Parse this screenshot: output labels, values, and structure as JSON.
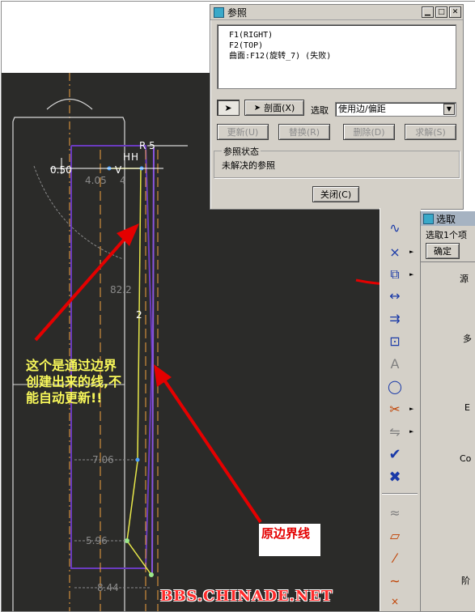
{
  "reference_dialog": {
    "title": "参照",
    "items": [
      "F1(RIGHT)",
      "F2(TOP)",
      "曲面:F12(旋转_7) (失败)"
    ],
    "pick_label": "剖面(X)",
    "choose_label": "选取",
    "choose_value": "使用边/偏距",
    "update_btn": "更新(U)",
    "replace_btn": "替换(R)",
    "delete_btn": "删除(D)",
    "solve_btn": "求解(S)",
    "status_group_label": "参照状态",
    "status_text": "未解决的参照",
    "close_btn": "关闭(C)",
    "min_glyph": "▁",
    "max_glyph": "□",
    "close_glyph": "✕"
  },
  "select_panel": {
    "title": "选取",
    "subtitle": "选取1个项",
    "confirm_btn": "确定",
    "side_chars": [
      "源",
      "多",
      "E",
      "Co",
      "阶"
    ]
  },
  "toolbar": {
    "icons": [
      "sketch-curve-icon",
      "point-icon",
      "offset-edge-icon",
      "dimension-icon",
      "modify-icon",
      "relation-icon",
      "text-icon",
      "palette-icon",
      "trim-icon",
      "mirror-icon",
      "accept-check-icon",
      "cancel-x-icon",
      "spline-icon",
      "parallelogram-icon",
      "line-icon",
      "wave-icon"
    ]
  },
  "dimensions": [
    "R 5",
    "0.50",
    "H",
    "H",
    "V",
    "4.05",
    "4",
    "82.2",
    "2",
    "7.06",
    "5.96",
    "8.44"
  ],
  "annotations": {
    "left_note": "这个是通过边界创建出来的线,不能自动更新!!",
    "right_note": "原边界线",
    "watermark": "BBS.CHINADE.NET"
  },
  "colors": {
    "viewport_bg": "#2b2b29",
    "dialog_bg": "#d4d0c8",
    "annotation_arrow": "#e40000",
    "yellow_note": "#f7f75a",
    "purple_line": "#6a3bbf",
    "orange_centerline": "#f0a040",
    "sketch_yellow": "#e8e84a"
  }
}
